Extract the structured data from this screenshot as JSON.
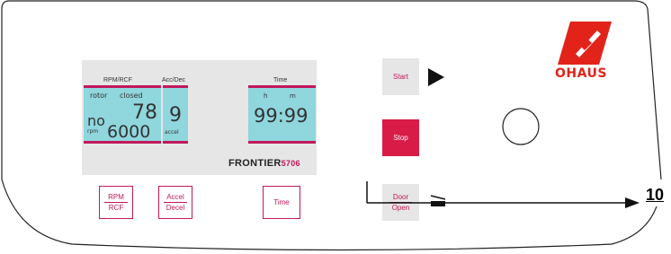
{
  "display": {
    "rpm_rcf_label": "RPM/RCF",
    "acc_dec_label": "Acc/Dec",
    "time_label": "Time",
    "rotor_label": "rotor",
    "closed_label": "closed",
    "rotor_value": "no",
    "rpm_unit": "rpm",
    "top_value": "78",
    "speed_value": "6000",
    "accel_value": "9",
    "accel_unit": "accel",
    "hours_label": "h",
    "minutes_label": "m",
    "time_value": "99:99"
  },
  "brand": {
    "name": "FRONTIER",
    "model": "5706"
  },
  "keys": {
    "rpm_top": "RPM",
    "rpm_bottom": "RCF",
    "accel_top": "Accel",
    "accel_bottom": "Decel",
    "time": "Time"
  },
  "buttons": {
    "start": "Start",
    "stop": "Stop",
    "door_top": "Door",
    "door_bottom": "Open"
  },
  "logo": {
    "text": "OHAUS"
  },
  "callout": {
    "label": "10"
  },
  "colors": {
    "accent": "#c2185b",
    "lcd": "#8fd6dd",
    "stop": "#d81b47",
    "logo": "#e2231a"
  }
}
